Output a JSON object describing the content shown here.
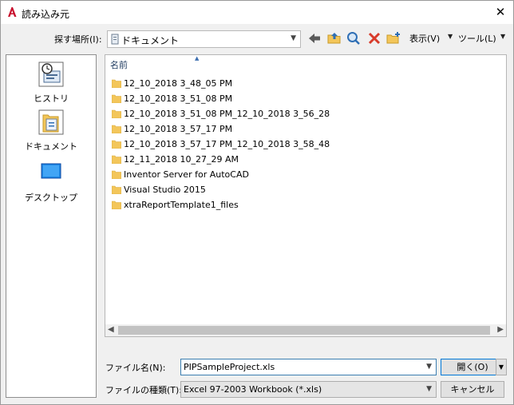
{
  "window": {
    "title": "読み込み元",
    "close_glyph": "✕"
  },
  "location": {
    "label": "探す場所(I):",
    "value": "ドキュメント"
  },
  "toolbar": {
    "icons": [
      "back-icon",
      "up-folder-icon",
      "search-web-icon",
      "delete-icon",
      "new-folder-icon"
    ],
    "view_label": "表示(V)",
    "tools_label": "ツール(L)"
  },
  "places": [
    {
      "label": "ヒストリ",
      "icon": "history-icon"
    },
    {
      "label": "ドキュメント",
      "icon": "documents-icon"
    },
    {
      "label": "デスクトップ",
      "icon": "desktop-icon"
    }
  ],
  "file_list": {
    "column_header": "名前",
    "items": [
      "12_10_2018 3_48_05 PM",
      "12_10_2018 3_51_08 PM",
      "12_10_2018 3_51_08 PM_12_10_2018 3_56_28",
      "12_10_2018 3_57_17 PM",
      "12_10_2018 3_57_17 PM_12_10_2018 3_58_48",
      "12_11_2018 10_27_29 AM",
      "Inventor Server for AutoCAD",
      "Visual Studio 2015",
      "xtraReportTemplate1_files"
    ]
  },
  "filename": {
    "label": "ファイル名(N):",
    "value": "PIPSampleProject.xls"
  },
  "filetype": {
    "label": "ファイルの種類(T):",
    "value": "Excel 97-2003 Workbook (*.xls)"
  },
  "buttons": {
    "open": "開く(O)",
    "cancel": "キャンセル"
  },
  "colors": {
    "folder": "#f3c65a",
    "accent": "#0078d7",
    "title_icon": "#c8102e"
  }
}
